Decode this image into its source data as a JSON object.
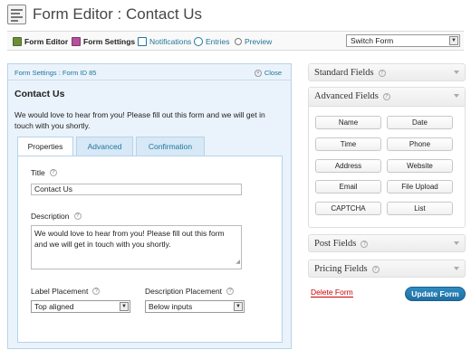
{
  "header": {
    "title": "Form Editor : Contact Us"
  },
  "toolbar": {
    "items": [
      {
        "label": "Form Editor"
      },
      {
        "label": "Form Settings"
      },
      {
        "label": "Notifications"
      },
      {
        "label": "Entries"
      },
      {
        "label": "Preview"
      }
    ],
    "switch_form": "Switch Form"
  },
  "settings": {
    "header_label": "Form Settings : Form ID 85",
    "close_label": "Close",
    "form_title": "Contact Us",
    "form_description": "We would love to hear from you! Please fill out this form and we will get in touch with you shortly.",
    "tabs": [
      {
        "label": "Properties",
        "active": true
      },
      {
        "label": "Advanced",
        "active": false
      },
      {
        "label": "Confirmation",
        "active": false
      }
    ],
    "properties": {
      "title_label": "Title",
      "title_value": "Contact Us",
      "description_label": "Description",
      "description_value": "We would love to hear from you! Please fill out this form and we will get in touch with you shortly.",
      "label_placement_label": "Label Placement",
      "label_placement_value": "Top aligned",
      "description_placement_label": "Description Placement",
      "description_placement_value": "Below inputs"
    }
  },
  "sidebar": {
    "standard_fields": "Standard Fields",
    "advanced_fields": "Advanced Fields",
    "advanced_buttons": [
      "Name",
      "Date",
      "Time",
      "Phone",
      "Address",
      "Website",
      "Email",
      "File Upload",
      "CAPTCHA",
      "List"
    ],
    "post_fields": "Post Fields",
    "pricing_fields": "Pricing Fields",
    "delete_label": "Delete Form",
    "update_label": "Update Form"
  },
  "colors": {
    "link": "#21759b",
    "panel_bg": "#eaf3fb",
    "primary_button": "#2e8bc0",
    "delete": "#cc0000"
  },
  "icons": [
    "form-editor-icon",
    "form-settings-icon",
    "notifications-icon",
    "entries-icon",
    "preview-icon",
    "help-icon",
    "close-icon",
    "chevron-down-icon"
  ]
}
